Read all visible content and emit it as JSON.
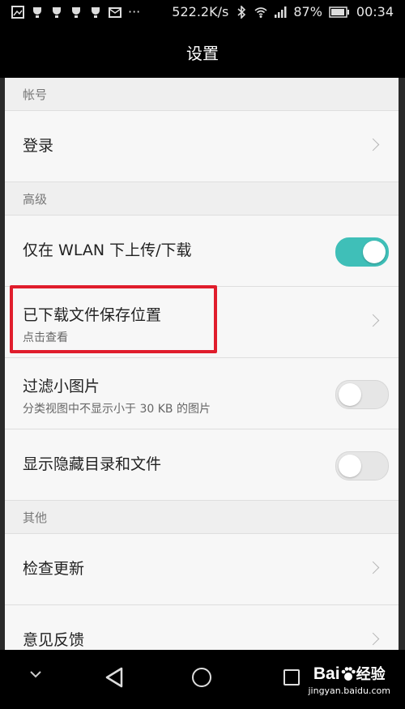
{
  "status_bar": {
    "speed": "522.2K/s",
    "dots": "···",
    "battery": "87%",
    "time": "00:34"
  },
  "header": {
    "title": "设置"
  },
  "sections": {
    "account": {
      "title": "帐号",
      "login": {
        "label": "登录"
      }
    },
    "advanced": {
      "title": "高级",
      "wlan_only": {
        "label": "仅在 WLAN 下上传/下载",
        "enabled": true
      },
      "download_location": {
        "label": "已下载文件保存位置",
        "sub": "点击查看"
      },
      "filter_small_images": {
        "label": "过滤小图片",
        "sub": "分类视图中不显示小于 30 KB 的图片",
        "enabled": false
      },
      "show_hidden": {
        "label": "显示隐藏目录和文件",
        "enabled": false
      }
    },
    "other": {
      "title": "其他",
      "check_update": {
        "label": "检查更新"
      },
      "feedback": {
        "label": "意见反馈"
      }
    }
  },
  "colors": {
    "toggle_on": "#3fbfb8",
    "highlight": "#e01d2c"
  },
  "watermark": {
    "brand_latin": "Bai",
    "brand_cn": "经验",
    "domain": "jingyan.baidu.com"
  }
}
